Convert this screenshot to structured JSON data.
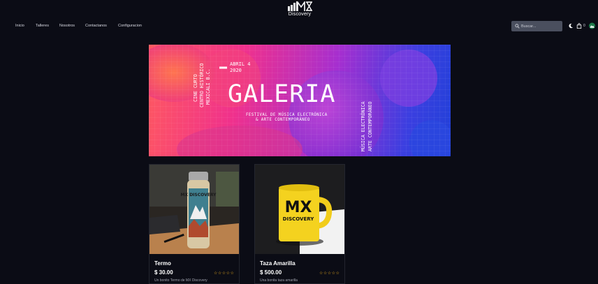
{
  "brand": {
    "name": "Discovery",
    "logo_letters": "MX"
  },
  "nav": [
    {
      "label": "Inicio"
    },
    {
      "label": "Talleres"
    },
    {
      "label": "Nosotros"
    },
    {
      "label": "Contactanos"
    },
    {
      "label": "Configuracion"
    }
  ],
  "search": {
    "placeholder": "Buscar..."
  },
  "toolbar": {
    "cart_count": "0"
  },
  "banner": {
    "title": "GALERIA",
    "date_line1": "ABRIL 4",
    "date_line2": "2020",
    "venue_line1": "CINE CURTO",
    "venue_line2": "CENTRO HISTÓRICO",
    "venue_line3": "MEXICALI B.C.",
    "subtitle_line1": "FESTIVAL DE MÚSICA ELECTRÓNICA",
    "subtitle_line2": "& ARTE CONTEMPORÁNEO",
    "side_line1": "MÚSICA ELECTRÓNICA",
    "side_line2": "ARTE CONTEMPORÁNEO"
  },
  "products": [
    {
      "title": "Termo",
      "price": "$ 30.00",
      "rating": "☆☆☆☆☆",
      "description": "Un bonito Termo de MX Discovery",
      "image_text": "MX DISCOVERY"
    },
    {
      "title": "Taza Amarilla",
      "price": "$ 500.00",
      "rating": "☆☆☆☆☆",
      "description": "Una bonita taza amarilla",
      "image_text_line1": "MX",
      "image_text_line2": "DISCOVERY"
    }
  ],
  "colors": {
    "background": "#0b0c15",
    "accent_star": "#f5b31e",
    "search_bg": "#4a4f5e"
  }
}
